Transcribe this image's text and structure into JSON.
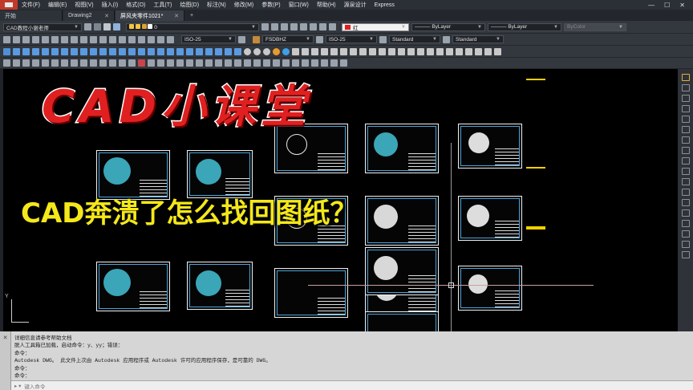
{
  "menubar": {
    "items": [
      "文件(F)",
      "编辑(E)",
      "视图(V)",
      "插入(I)",
      "格式(O)",
      "工具(T)",
      "绘图(D)",
      "标注(N)",
      "修改(M)",
      "参数(P)",
      "窗口(W)",
      "帮助(H)",
      "源泉设计",
      "Express"
    ],
    "minimize": "—",
    "maximize": "☐",
    "close": "✕"
  },
  "tabs": [
    {
      "label": "开始",
      "active": false
    },
    {
      "label": "Drawing2",
      "active": false,
      "close": "✕"
    },
    {
      "label": "屏风夹零件1021*",
      "active": true,
      "close": "✕"
    }
  ],
  "tab_add": "+",
  "toolbar": {
    "workspace": "CAD教程小谢老师",
    "layer_value": "0",
    "color_value": "红",
    "linetype1": "ByLayer",
    "linetype2": "ByLayer",
    "lineweight": "ByColor",
    "dimstyle1": "ISO-25",
    "textstyle": "FSDBHZ",
    "dimstyle2": "ISO-25",
    "tablestyle": "Standard",
    "mleaderstyle": "Standard",
    "dimstyle3": "ISO-25",
    "accent_red": "#e02020"
  },
  "overlay": {
    "title": "CAD小课堂",
    "subtitle": "CAD奔溃了怎么找回图纸？"
  },
  "canvas": {
    "ucs_label": "Y",
    "background": "#000000"
  },
  "command": {
    "lines": [
      "详细信息请参考帮助文档",
      "脱人工具箱已加载，启动命令：y、yy；错误：",
      "命令：",
      "Autodesk DWG。  此文件上次由 Autodesk 应用程序或 Autodesk 许可的应用程序保存，是可靠的 DWG。",
      "命令：",
      "命令："
    ],
    "placeholder": "键入命令",
    "side_label": "✕"
  }
}
